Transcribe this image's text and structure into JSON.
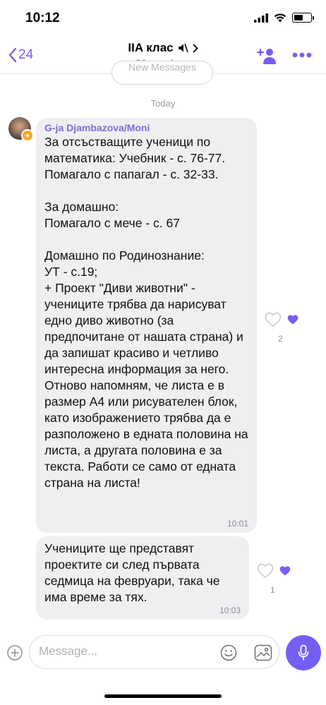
{
  "status_bar": {
    "time": "10:12"
  },
  "header": {
    "back_count": "24",
    "title": "IIA клас",
    "subtitle": "36 members"
  },
  "chat": {
    "new_messages_label": "New Messages",
    "date_separator": "Today",
    "messages": [
      {
        "sender": "G-ja Djambazova/Moni",
        "text": "За отсъстващите ученици по математика: Учебник - с. 76-77. Помагало с папагал - с. 32-33.\n\nЗа домашно:\nПомагало с мече - с. 67\n\nДомашно по Родинознание:\nУТ - с.19;\n+ Проект \"Диви животни\" - учениците трябва да нарисуват едно диво животно (за предпочитане от нашата страна) и да запишат красиво и четливо интересна информация за него.\nОтново напомням, че листа е в размер А4 или рисувателен блок, като изображението трябва да е разположено в едната половина на листа, а другата половина е за текста. Работи се само от едната страна на листа!",
        "time": "10:01",
        "like_count": "2"
      },
      {
        "text": "Учениците ще представят проектите си след първата седмица на февруари, така че има време за тях.",
        "time": "10:03",
        "like_count": "1"
      }
    ]
  },
  "input": {
    "placeholder": "Message..."
  },
  "colors": {
    "accent": "#7360f2",
    "bubble": "#efeff2",
    "sender": "#7e6cd9"
  }
}
